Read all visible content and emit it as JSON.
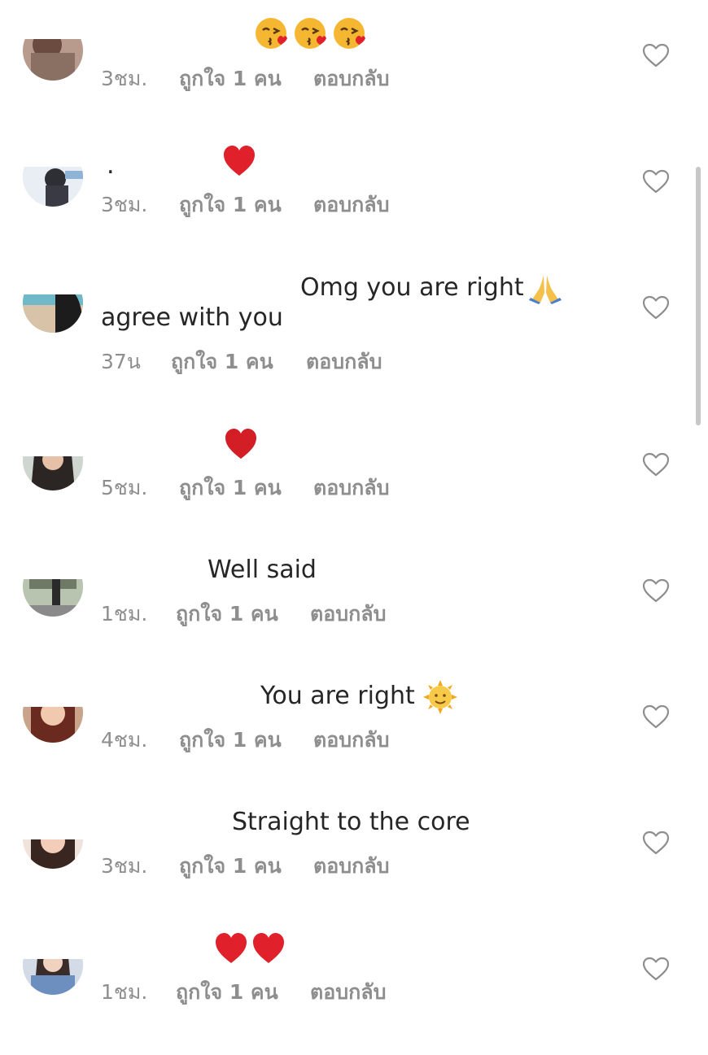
{
  "comments": [
    {
      "text": "",
      "emoji": "😘😘😘",
      "time": "3ชม.",
      "likes": "ถูกใจ 1 คน",
      "reply": "ตอบกลับ"
    },
    {
      "text": ".",
      "emoji": "❤️",
      "time": "3ชม.",
      "likes": "ถูกใจ 1 คน",
      "reply": "ตอบกลับ"
    },
    {
      "text": "Omg you are right",
      "emoji": "🙏",
      "text2": "agree with you",
      "time": "37น",
      "likes": "ถูกใจ 1 คน",
      "reply": "ตอบกลับ"
    },
    {
      "text": "",
      "emoji": "❤️",
      "time": "5ชม.",
      "likes": "ถูกใจ 1 คน",
      "reply": "ตอบกลับ"
    },
    {
      "text": "Well said",
      "emoji": "",
      "time": "1ชม.",
      "likes": "ถูกใจ 1 คน",
      "reply": "ตอบกลับ"
    },
    {
      "text": "You are right",
      "emoji": "🌞",
      "time": "4ชม.",
      "likes": "ถูกใจ 1 คน",
      "reply": "ตอบกลับ"
    },
    {
      "text": "Straight to the core",
      "emoji": "",
      "time": "3ชม.",
      "likes": "ถูกใจ 1 คน",
      "reply": "ตอบกลับ"
    },
    {
      "text": "",
      "emoji": "❤️❤️",
      "time": "1ชม.",
      "likes": "ถูกใจ 1 คน",
      "reply": "ตอบกลับ"
    }
  ],
  "icons": {
    "like": "heart-outline-icon",
    "emoji_heart": "red-heart"
  },
  "colors": {
    "text": "#262626",
    "meta": "#8e8e8e",
    "heart_outline": "#8e8e8e",
    "red_heart": "#e0202a",
    "scrollbar": "#c7c7c7"
  }
}
